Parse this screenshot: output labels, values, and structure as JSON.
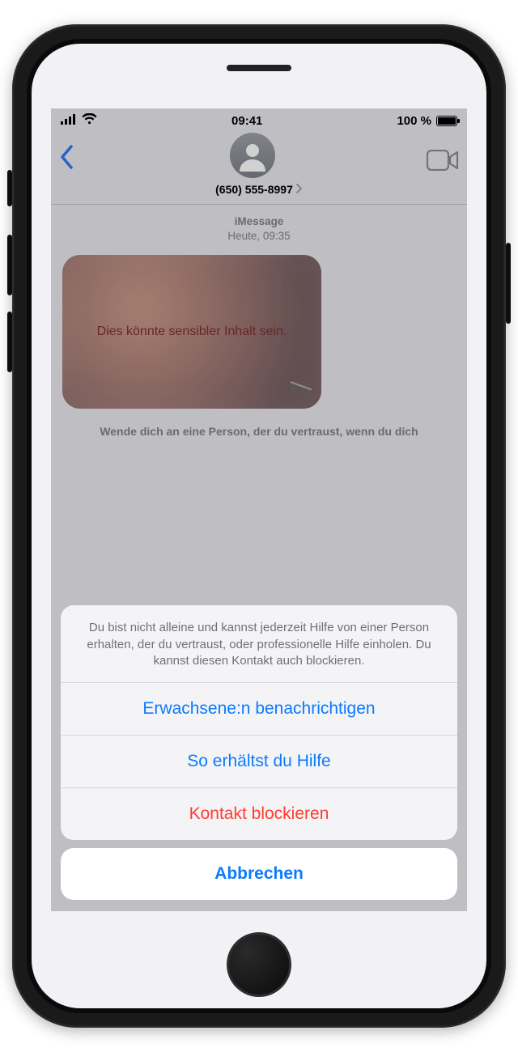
{
  "status": {
    "time": "09:41",
    "battery_pct": "100 %"
  },
  "header": {
    "contact": "(650) 555-8997"
  },
  "thread": {
    "service": "iMessage",
    "timestamp": "Heute, 09:35",
    "sensitive_label": "Dies könnte sensibler Inhalt sein.",
    "caption": "Wende dich an eine Person, der du vertraust, wenn du dich"
  },
  "sheet": {
    "message": "Du bist nicht alleine und kannst jederzeit Hilfe von einer Person erhalten, der du vertraust, oder professionelle Hilfe einholen. Du kannst diesen Kontakt auch blockieren.",
    "notify": "Erwachsene:n benachrichtigen",
    "help": "So erhältst du Hilfe",
    "block": "Kontakt blockieren",
    "cancel": "Abbrechen"
  }
}
